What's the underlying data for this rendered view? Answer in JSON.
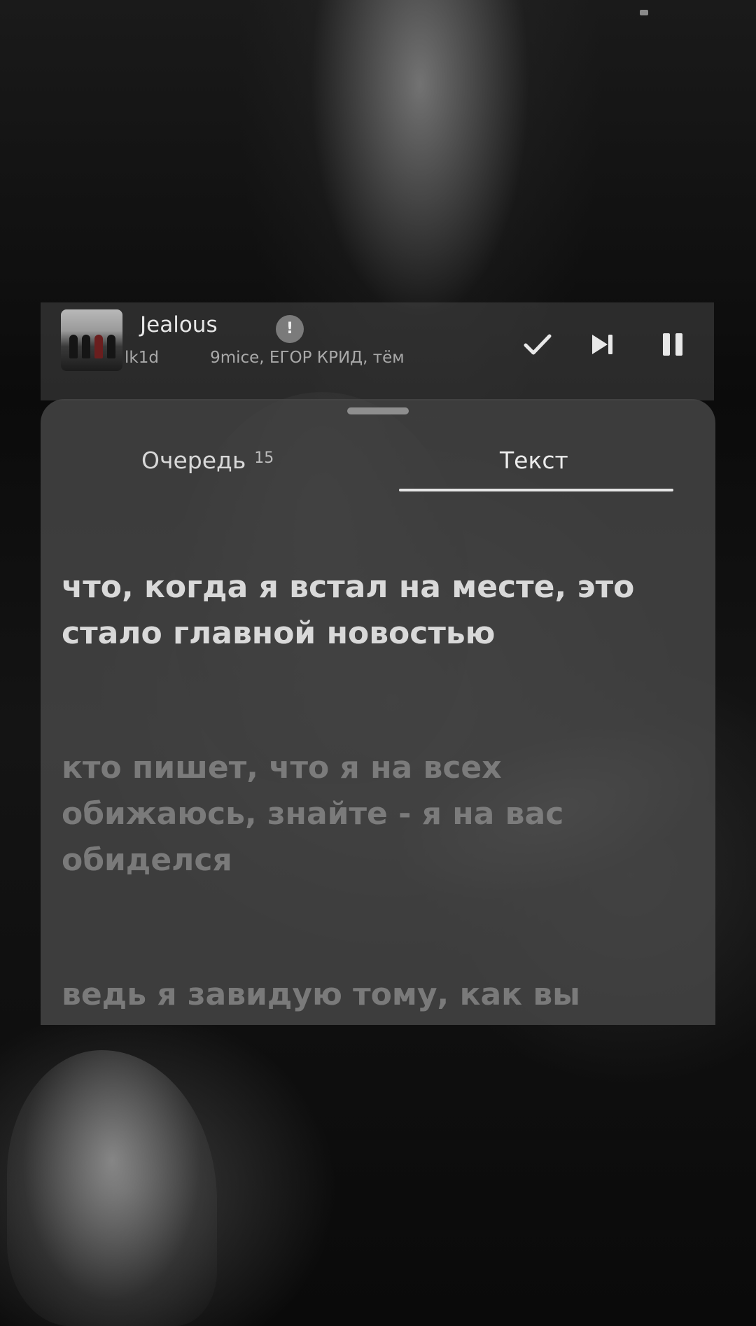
{
  "mini_player": {
    "title": "Jealous",
    "explicit_mark": "!",
    "artists_prefix": "lk1d",
    "artists": "9mice, ЕГОР КРИД, тём"
  },
  "sheet": {
    "tabs": [
      {
        "label": "Очередь",
        "count": "15"
      },
      {
        "label": "Текст"
      }
    ],
    "active_tab": "Текст",
    "lyrics": [
      "что, когда я встал на месте, это стало главной новостью",
      "кто пишет, что я на всех обижаюсь, знайте - я на вас обиделся",
      "ведь я завидую тому, как вы завидуете"
    ]
  },
  "icons": {
    "like": "check-icon",
    "next": "skip-next-icon",
    "pause": "pause-icon"
  },
  "colors": {
    "panel": "#484848",
    "text_active": "#d9d9d9",
    "text_dim": "#8c8c8c",
    "accent_underline": "#e5e5e5"
  }
}
